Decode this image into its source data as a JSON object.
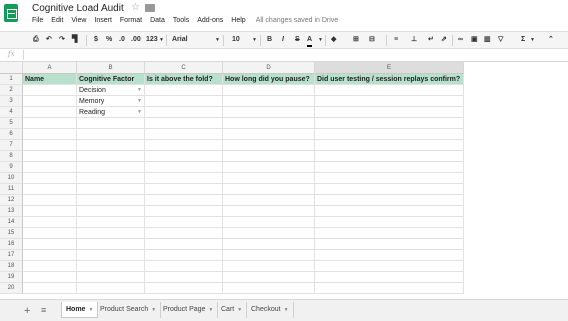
{
  "doc": {
    "title": "Cognitive Load Audit",
    "saved_status": "All changes saved in Drive"
  },
  "menu": [
    "File",
    "Edit",
    "View",
    "Insert",
    "Format",
    "Data",
    "Tools",
    "Add-ons",
    "Help"
  ],
  "toolbar": {
    "currency": "$",
    "percent": "%",
    "dec_decrease": ".0",
    "dec_increase": ".00",
    "more_formats": "123",
    "font": "Arial",
    "font_size": "10",
    "bold": "B",
    "italic": "I",
    "strike": "S",
    "text_color": "A",
    "sum": "Σ"
  },
  "formula_bar": {
    "label": "fx",
    "value": ""
  },
  "columns": [
    "A",
    "B",
    "C",
    "D",
    "E"
  ],
  "rows": [
    "1",
    "2",
    "3",
    "4",
    "5",
    "6",
    "7",
    "8",
    "9",
    "10",
    "11",
    "12",
    "13",
    "14",
    "15",
    "16",
    "17",
    "18",
    "19",
    "20"
  ],
  "header_row": [
    "Name",
    "Cognitive Factor",
    "Is it above the fold?",
    "How long did you pause?",
    "Did user testing / session replays confirm?"
  ],
  "cognitive_factors": [
    "Decision",
    "Memory",
    "Reading"
  ],
  "sheet_tabs": [
    "Home",
    "Product Search",
    "Product Page",
    "Cart",
    "Checkout"
  ],
  "active_tab": "Home",
  "colors": {
    "header_fill": "#b7e1cd",
    "brand_green": "#0f9d58"
  }
}
